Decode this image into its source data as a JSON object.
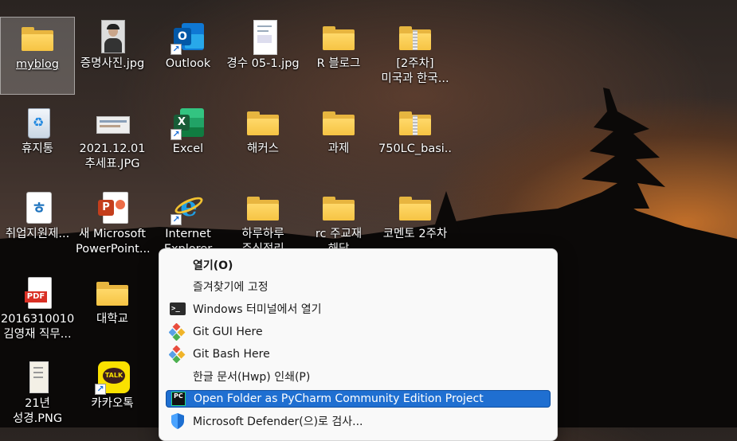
{
  "desktop": {
    "icons": [
      {
        "label": "myblog"
      },
      {
        "label": "증명사진.jpg"
      },
      {
        "label": "Outlook"
      },
      {
        "label": "경수 05-1.jpg"
      },
      {
        "label": "R 블로그"
      },
      {
        "label": "[2주차]\n미국과 한국..."
      },
      {
        "label": "휴지통"
      },
      {
        "label": "2021.12.01\n추세표.JPG"
      },
      {
        "label": "Excel"
      },
      {
        "label": "해커스"
      },
      {
        "label": "과제"
      },
      {
        "label": "750LC_basi..."
      },
      {
        "label": "취업지원제..."
      },
      {
        "label": "새 Microsoft\nPowerPoint..."
      },
      {
        "label": "Internet\nExplorer"
      },
      {
        "label": "하루하루\n주식정리"
      },
      {
        "label": "rc 주교재\n해답"
      },
      {
        "label": "코멘토 2주차"
      },
      {
        "label": "2016310010\n김영재 직무..."
      },
      {
        "label": "대학교"
      },
      {
        "label": "21년\n성경.PNG"
      },
      {
        "label": "카카오톡"
      }
    ]
  },
  "context_menu": {
    "items": [
      {
        "label": "열기(O)",
        "icon": ""
      },
      {
        "label": "즐겨찾기에 고정",
        "icon": ""
      },
      {
        "label": "Windows 터미널에서 열기",
        "icon": "terminal-icon"
      },
      {
        "label": "Git GUI Here",
        "icon": "git-icon"
      },
      {
        "label": "Git Bash Here",
        "icon": "git-icon"
      },
      {
        "label": "한글 문서(Hwp) 인쇄(P)",
        "icon": ""
      },
      {
        "label": "Open Folder as PyCharm Community Edition Project",
        "icon": "pycharm-icon"
      },
      {
        "label": "Microsoft Defender(으)로 검사...",
        "icon": "defender-shield-icon"
      }
    ]
  },
  "colors": {
    "menu_highlight": "#1f6fd1",
    "folder": "#f6c443"
  }
}
